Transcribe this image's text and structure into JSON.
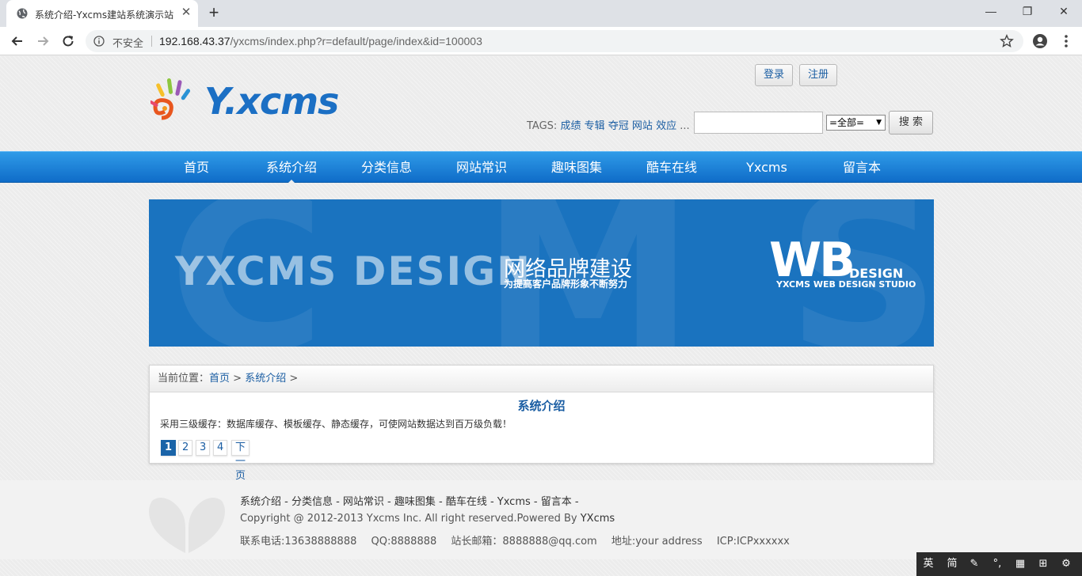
{
  "browser": {
    "tab_title": "系统介绍-Yxcms建站系统演示站",
    "security_label": "不安全",
    "url_host": "192.168.43.37",
    "url_path": "/yxcms/index.php?r=default/page/index&id=100003"
  },
  "header": {
    "logo_text": "Y.xcms",
    "login_label": "登录",
    "register_label": "注册",
    "tags_label": "TAGS:",
    "tags": [
      "成绩",
      "专辑",
      "夺冠",
      "网站",
      "效应"
    ],
    "tags_more": "...",
    "search_placeholder": "",
    "search_select": "=全部=",
    "search_button": "搜 索"
  },
  "nav": {
    "items": [
      "首页",
      "系统介绍",
      "分类信息",
      "网站常识",
      "趣味图集",
      "酷车在线",
      "Yxcms",
      "留言本"
    ],
    "active_index": 1
  },
  "banner": {
    "bg_letters": [
      "C",
      "M",
      "S"
    ],
    "main_text": "YXCMS DESIGN",
    "cn_title": "网络品牌建设",
    "cn_sub": "为提高客户品牌形象不断努力",
    "wb": "WB",
    "design": "DESIGN",
    "studio": "YXCMS WEB DESIGN STUDIO"
  },
  "content": {
    "crumb_label": "当前位置：",
    "crumb_home": "首页",
    "crumb_sep": ">",
    "crumb_current": "系统介绍",
    "title": "系统介绍",
    "body": "采用三级缓存：数据库缓存、模板缓存、静态缓存，可使网站数据达到百万级负载！",
    "pages": [
      "1",
      "2",
      "3",
      "4"
    ],
    "next_label": "下一页",
    "current_page": 1
  },
  "footer": {
    "links": "系统介绍 - 分类信息 - 网站常识 - 趣味图集 - 酷车在线 - Yxcms - 留言本 -",
    "copyright": "Copyright @ 2012-2013 Yxcms Inc. All right reserved.Powered By ",
    "powered_by": "YXcms",
    "phone": "联系电话:13638888888",
    "qq": "QQ:8888888",
    "email": "站长邮箱：8888888@qq.com",
    "address": "地址:your address",
    "icp": "ICP:ICPxxxxxx"
  },
  "ime": {
    "items": [
      "英",
      "简"
    ]
  },
  "colors": {
    "accent": "#1b5ea3",
    "nav_top": "#2f9be8",
    "nav_bottom": "#0f6cc8",
    "banner": "#1a73bf"
  }
}
